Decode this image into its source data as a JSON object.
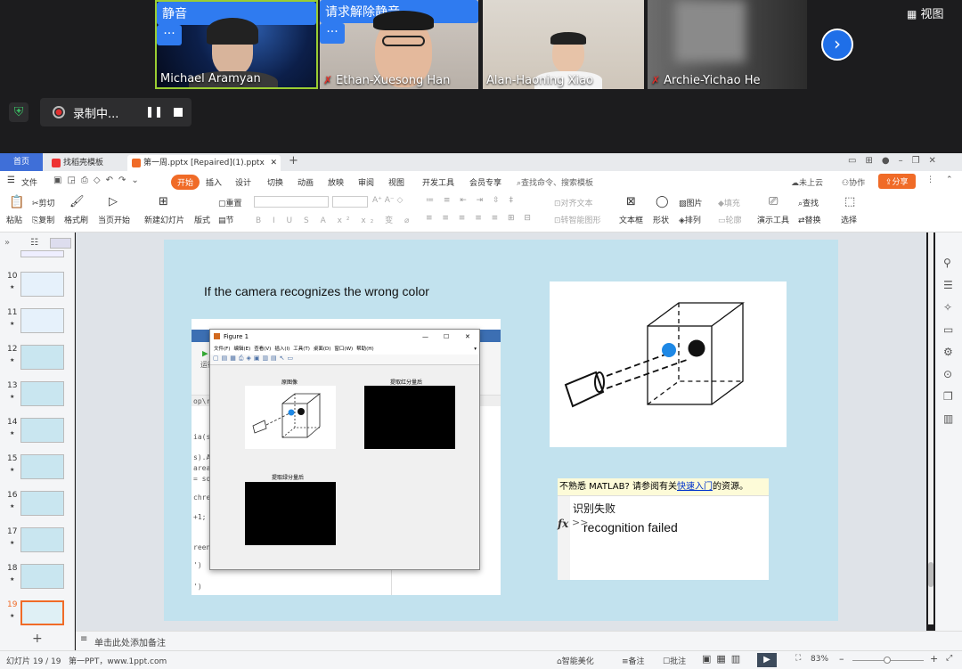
{
  "meeting": {
    "participants": [
      {
        "name": "Michael Aramyan",
        "muted": false
      },
      {
        "name": "Ethan-Xuesong Han",
        "muted": true
      },
      {
        "name": "Alan-Haoning Xiao",
        "muted": false
      },
      {
        "name": "Archie-Yichao He",
        "muted": true
      }
    ],
    "mute_label": "静音",
    "unmute_request_label": "请求解除静音",
    "more_label": "···",
    "view_label": "视图",
    "recording_label": "录制中..."
  },
  "tabs": {
    "home": "首页",
    "template": "找稻壳模板",
    "document": "第一周.pptx [Repaired](1).pptx"
  },
  "menu": {
    "file": "文件",
    "start": "开始",
    "items": [
      "插入",
      "设计",
      "切换",
      "动画",
      "放映",
      "审阅",
      "视图",
      "开发工具",
      "会员专享"
    ],
    "search": "查找命令、搜索模板",
    "cloud": "未上云",
    "collab": "协作",
    "share": "分享"
  },
  "ribbon": {
    "paste": "粘贴",
    "cut": "剪切",
    "copy": "复制",
    "format_painter": "格式刷",
    "from_current": "当页开始",
    "new_slide": "新建幻灯片",
    "layout": "版式",
    "reset": "重置",
    "section": "节",
    "align_text": "对齐文本",
    "smart_shape": "转智能图形",
    "textbox": "文本框",
    "shape": "形状",
    "picture": "图片",
    "arrange": "排列",
    "fill": "填充",
    "outline": "轮廓",
    "present_tools": "演示工具",
    "find": "查找",
    "replace": "替换",
    "select": "选择"
  },
  "slides": {
    "numbers": [
      "10",
      "11",
      "12",
      "13",
      "14",
      "15",
      "16",
      "17",
      "18",
      "19"
    ],
    "active": "19"
  },
  "slide": {
    "heading": "If the camera recognizes the wrong color",
    "figure": {
      "title": "Figure 1",
      "menus": [
        "文件(F)",
        "编辑(E)",
        "查看(V)",
        "插入(I)",
        "工具(T)",
        "桌面(D)",
        "窗口(W)",
        "帮助(H)"
      ],
      "plot_original": "原图像",
      "plot_red": "提取红分量后",
      "plot_green": "提取绿分量后"
    },
    "matlab_partial": [
      "op\\rec",
      "ia(sqr",
      "s).Are",
      "area/",
      "= sqr",
      "chresh",
      "+1;",
      "reen_c",
      "')",
      "')",
      "运行"
    ],
    "console": {
      "hint_prefix": "不熟悉 MATLAB? 请参阅有关",
      "hint_link": "快速入门",
      "hint_suffix": "的资源。",
      "line1": "识别失败",
      "line2": "recognition failed",
      "fx": "fx",
      "prompt": ">>"
    }
  },
  "notes_placeholder": "单击此处添加备注",
  "status": {
    "slide_count": "幻灯片 19 / 19",
    "theme": "第一PPT，www.1ppt.com",
    "beautify": "智能美化",
    "notes": "备注",
    "comments": "批注",
    "zoom": "83%"
  },
  "colors": {
    "accent_blue": "#2f7bf0",
    "slide_bg": "#c2e2ee",
    "wps_orange": "#f06b27"
  }
}
